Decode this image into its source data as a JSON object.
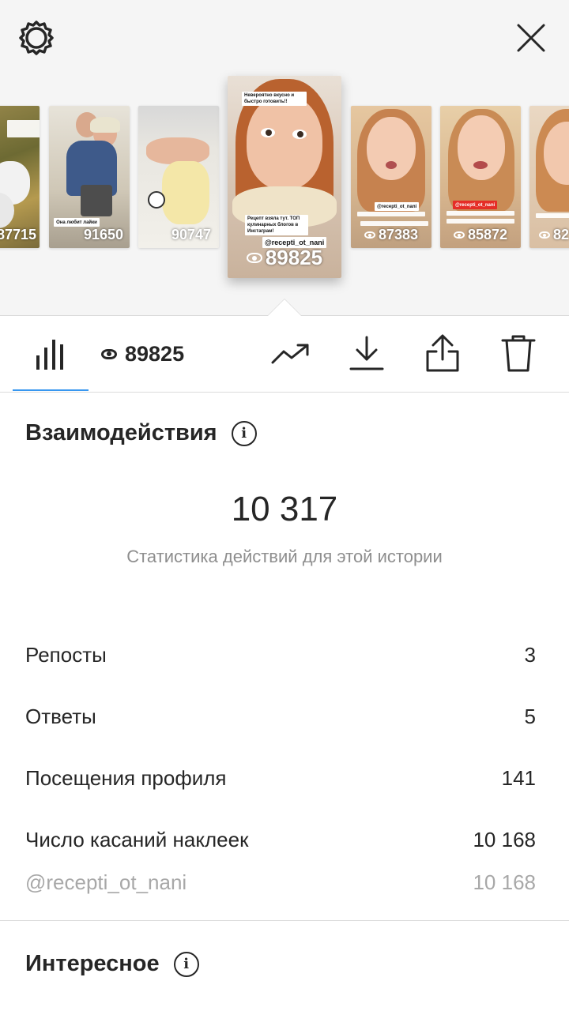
{
  "top": {
    "settings_icon": "gear-icon",
    "close_icon": "close-icon"
  },
  "stories": [
    {
      "views": "87715",
      "kind": "dog"
    },
    {
      "views": "91650",
      "kind": "couple",
      "tag": "Она любит лайки"
    },
    {
      "views": "90747",
      "kind": "cheese"
    },
    {
      "views": "89825",
      "kind": "girl-selected",
      "selected": true,
      "top_text": "Невероятно вкусно и быстро готовить!!",
      "caption_text": "Рецепт взяла тут. ТОП кулинарных блогов в Инстаграм!",
      "tag": "@recepti_ot_nani"
    },
    {
      "views": "87383",
      "kind": "girl",
      "tag": "@recepti_ot_nani"
    },
    {
      "views": "85872",
      "kind": "girl-red",
      "tag": "@recepti_ot_nani"
    },
    {
      "views": "82",
      "kind": "girl-partial"
    }
  ],
  "toolbar": {
    "stats_icon": "bar-chart-icon",
    "views": "89825",
    "trend_icon": "trend-up-icon",
    "download_icon": "download-icon",
    "share_icon": "share-icon",
    "delete_icon": "trash-icon"
  },
  "interactions": {
    "title": "Взаимодействия",
    "total": "10 317",
    "caption": "Статистика действий для этой истории",
    "rows": [
      {
        "label": "Репосты",
        "value": "3"
      },
      {
        "label": "Ответы",
        "value": "5"
      },
      {
        "label": "Посещения профиля",
        "value": "141"
      },
      {
        "label": "Число касаний наклеек",
        "value": "10 168"
      }
    ],
    "sub_row": {
      "label": "@recepti_ot_nani",
      "value": "10 168"
    }
  },
  "discovery": {
    "title": "Интересное"
  },
  "colors": {
    "accent": "#3897f0",
    "text": "#262626",
    "muted": "#8e8e8e",
    "background_top": "#f5f5f5"
  }
}
